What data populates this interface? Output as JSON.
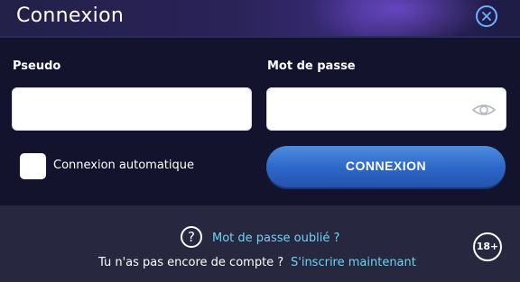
{
  "header": {
    "title": "Connexion"
  },
  "form": {
    "username_label": "Pseudo",
    "username_value": "",
    "password_label": "Mot de passe",
    "password_value": "",
    "remember_label": "Connexion automatique",
    "remember_checked": false,
    "submit_label": "CONNEXION"
  },
  "footer": {
    "forgot_label": "Mot de passe oublié ?",
    "no_account_text": "Tu n'as pas encore de compte ?",
    "signup_label": "S'inscrire maintenant",
    "age_badge": "18+"
  },
  "icons": {
    "close": "close-icon",
    "show_password": "eye-icon",
    "help": "question-icon"
  }
}
